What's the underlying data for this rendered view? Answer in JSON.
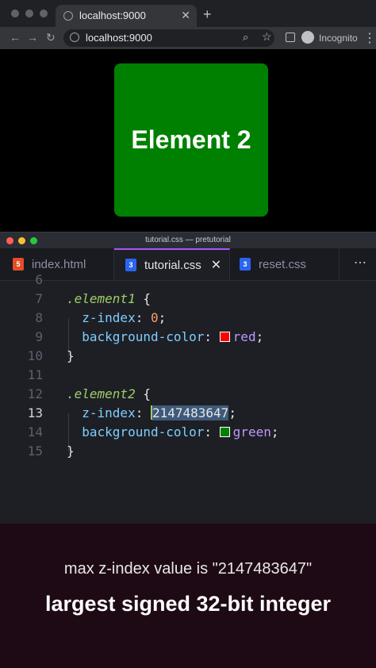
{
  "browser": {
    "tab_title": "localhost:9000",
    "url": "localhost:9000",
    "profile_label": "Incognito"
  },
  "page": {
    "element_label": "Element 2",
    "element_color": "#008000"
  },
  "editor": {
    "window_title": "tutorial.css — pretutorial",
    "tabs": [
      {
        "label": "index.html",
        "icon": "html5-icon"
      },
      {
        "label": "tutorial.css",
        "icon": "css3-icon"
      },
      {
        "label": "reset.css",
        "icon": "css3-icon"
      }
    ],
    "line_numbers": [
      "6",
      "7",
      "8",
      "9",
      "10",
      "11",
      "12",
      "13",
      "14",
      "15"
    ],
    "code": {
      "l7_selector": ".element1",
      "l8_prop": "z-index",
      "l8_value": "0",
      "l9_prop": "background-color",
      "l9_value": "red",
      "l12_selector": ".element2",
      "l13_prop": "z-index",
      "l13_value": "2147483647",
      "l14_prop": "background-color",
      "l14_value": "green"
    }
  },
  "caption": {
    "line1": "max z-index value is \"2147483647\"",
    "line2": "largest signed 32-bit integer"
  }
}
